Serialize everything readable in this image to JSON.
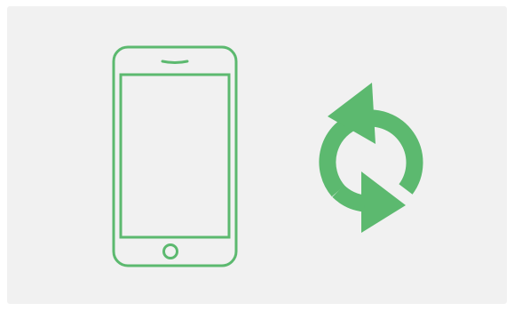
{
  "illustration": {
    "background_color": "#f1f1f1",
    "phone": {
      "icon": "smartphone-outline-icon",
      "color": "#5cb96f"
    },
    "sync": {
      "icon": "refresh-arrows-icon",
      "color": "#5cb96f"
    }
  }
}
